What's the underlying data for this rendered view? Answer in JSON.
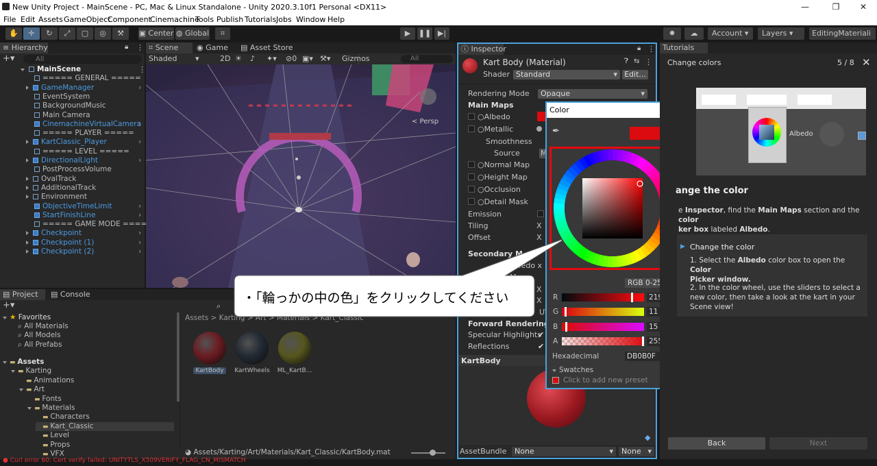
{
  "window": {
    "title": "New Unity Project - MainScene - PC, Mac & Linux Standalone - Unity 2020.3.10f1 Personal <DX11>"
  },
  "menu": [
    "File",
    "Edit",
    "Assets",
    "GameObject",
    "Component",
    "Cinemachine",
    "Tools",
    "Publish",
    "Tutorials",
    "Jobs",
    "Window",
    "Help"
  ],
  "toolbar": {
    "center": "Center",
    "global": "Global",
    "account": "Account",
    "layers": "Layers",
    "layout": "EditingMateriali"
  },
  "hierarchy": {
    "tab": "Hierarchy",
    "search_placeholder": "All",
    "items": [
      {
        "label": "MainScene",
        "style": "white",
        "indent": 0,
        "expand": "down"
      },
      {
        "label": "===== GENERAL =====",
        "style": "grey",
        "indent": 1
      },
      {
        "label": "GameManager",
        "style": "blue",
        "indent": 1,
        "expand": "right",
        "arrow": true
      },
      {
        "label": "EventSystem",
        "style": "grey",
        "indent": 1
      },
      {
        "label": "BackgroundMusic",
        "style": "grey",
        "indent": 1
      },
      {
        "label": "Main Camera",
        "style": "grey",
        "indent": 1
      },
      {
        "label": "CinemachineVirtualCamera",
        "style": "blue",
        "indent": 1,
        "arrow": true
      },
      {
        "label": "===== PLAYER =====",
        "style": "grey",
        "indent": 1
      },
      {
        "label": "KartClassic_Player",
        "style": "blue",
        "indent": 1,
        "expand": "right",
        "arrow": true
      },
      {
        "label": "===== LEVEL =====",
        "style": "grey",
        "indent": 1
      },
      {
        "label": "DirectionalLight",
        "style": "blue",
        "indent": 1,
        "expand": "right",
        "arrow": true
      },
      {
        "label": "PostProcessVolume",
        "style": "grey",
        "indent": 1
      },
      {
        "label": "OvalTrack",
        "style": "grey",
        "indent": 1,
        "expand": "right"
      },
      {
        "label": "AdditionalTrack",
        "style": "grey",
        "indent": 1,
        "expand": "right"
      },
      {
        "label": "Environment",
        "style": "grey",
        "indent": 1,
        "expand": "right"
      },
      {
        "label": "ObjectiveTimeLimit",
        "style": "blue",
        "indent": 1,
        "arrow": true
      },
      {
        "label": "StartFinishLine",
        "style": "blue",
        "indent": 1,
        "arrow": true
      },
      {
        "label": "===== GAME MODE =====",
        "style": "grey",
        "indent": 1
      },
      {
        "label": "Checkpoint",
        "style": "blue",
        "indent": 1,
        "expand": "right",
        "arrow": true
      },
      {
        "label": "Checkpoint (1)",
        "style": "blue",
        "indent": 1,
        "expand": "right",
        "arrow": true
      },
      {
        "label": "Checkpoint (2)",
        "style": "blue",
        "indent": 1,
        "expand": "right",
        "arrow": true
      }
    ]
  },
  "scene": {
    "tabs": [
      "Scene",
      "Game",
      "Asset Store"
    ],
    "shading": "Shaded",
    "twoD": "2D",
    "gizmos": "Gizmos",
    "search": "All",
    "persp": "< Persp",
    "count": "0"
  },
  "project": {
    "tabs": [
      "Project",
      "Console"
    ],
    "favorites_label": "Favorites",
    "favorites": [
      "All Materials",
      "All Models",
      "All Prefabs"
    ],
    "tree": [
      {
        "label": "Assets",
        "indent": 0
      },
      {
        "label": "Karting",
        "indent": 1
      },
      {
        "label": "Animations",
        "indent": 2
      },
      {
        "label": "Art",
        "indent": 2
      },
      {
        "label": "Fonts",
        "indent": 3
      },
      {
        "label": "Materials",
        "indent": 3
      },
      {
        "label": "Characters",
        "indent": 4
      },
      {
        "label": "Kart_Classic",
        "indent": 4
      },
      {
        "label": "Level",
        "indent": 4
      },
      {
        "label": "Props",
        "indent": 4
      },
      {
        "label": "VFX",
        "indent": 4
      }
    ],
    "breadcrumb": "Assets > Karting > Art > Materials > Kart_Classic",
    "assets": [
      {
        "name": "KartBody",
        "color": "#6b1c22"
      },
      {
        "name": "KartWheels",
        "color": "#222a33"
      },
      {
        "name": "ML_KartB...",
        "color": "#56561e"
      }
    ],
    "path": "Assets/Karting/Art/Materials/Kart_Classic/KartBody.mat"
  },
  "inspector": {
    "tab": "Inspector",
    "title": "Kart Body (Material)",
    "shader_label": "Shader",
    "shader": "Standard",
    "edit": "Edit...",
    "rendering_mode_label": "Rendering Mode",
    "rendering_mode": "Opaque",
    "main_maps": "Main Maps",
    "albedo": "Albedo",
    "metallic": "Metallic",
    "smoothness": "Smoothness",
    "source": "Source",
    "source_val": "M",
    "normal_map": "Normal Map",
    "height_map": "Height Map",
    "occlusion": "Occlusion",
    "detail_mask": "Detail Mask",
    "emission": "Emission",
    "tiling": "Tiling",
    "offset": "Offset",
    "x": "X",
    "secondary_maps": "Secondary M",
    "detail_albedo": "Albedo x",
    "normal_map2": "ormal Map",
    "uv": "UV",
    "forward_opts": "Forward Rendering Opt",
    "specular": "Specular Highlights",
    "reflections": "Reflections",
    "kartbody": "KartBody",
    "assetbundle": "AssetBundle",
    "none1": "None",
    "none2": "None"
  },
  "color_picker": {
    "title": "Color",
    "mode": "RGB 0-255",
    "r_label": "R",
    "r": "219",
    "g_label": "G",
    "g": "11",
    "b_label": "B",
    "b": "15",
    "a_label": "A",
    "a": "255",
    "hex_label": "Hexadecimal",
    "hex": "DB0B0F",
    "swatches": "Swatches",
    "add_preset": "Click to add new preset",
    "current_color": "#db0b0f"
  },
  "callout": {
    "text": "・「輪っかの中の色」をクリックしてください"
  },
  "tutorials": {
    "tab": "Tutorials",
    "step_title": "Change colors",
    "progress": "5 / 8",
    "albedo": "Albedo",
    "heading": "ange the color",
    "body_prefix": "e ",
    "body_insp": "Inspector",
    "body_mid": ", find the ",
    "body_mainmaps": "Main Maps",
    "body_mid2": " section and the ",
    "body_color": "color",
    "body_line2a": "ker box",
    "body_line2b": " labeled ",
    "body_albedo": "Albedo",
    "body_end": ".",
    "task_title": "Change the color",
    "s1a": "1. Select the ",
    "s1b": "Albedo",
    "s1c": " color box to open the ",
    "s1d": "Color",
    "s1e": "Picker window.",
    "s2": "2. In the color wheel, use the sliders to select a new color, then take a look at the kart in your Scene view!",
    "back": "Back",
    "next": "Next"
  },
  "status": {
    "text": "Curl error 60: Cert verify failed: UNITYTLS_X509VERIFY_FLAG_CN_MISMATCH"
  }
}
